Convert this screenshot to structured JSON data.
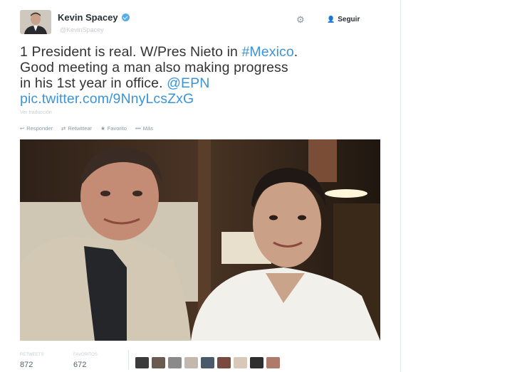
{
  "profile": {
    "name": "Kevin Spacey",
    "handle": "@KevinSpacey",
    "follow_label": "Seguir"
  },
  "tweet": {
    "line1_text": "1 President is real. W/Pres Nieto in ",
    "line1_hashtag": "#Mexico",
    "line1_end": ".",
    "line2": "Good meeting a man also making progress",
    "line3_text": "in his 1st year in office. ",
    "line3_mention": "@EPN",
    "line4_link": "pic.twitter.com/9NnyLcsZxG"
  },
  "location": "Ver traducción",
  "actions": {
    "reply": "Responder",
    "retweet": "Retwittear",
    "favorite": "Favorito",
    "more": "Más"
  },
  "stats": {
    "retweets_label": "RETWEETS",
    "retweets": "872",
    "favorites_label": "FAVORITOS",
    "favorites": "672"
  },
  "faces_colors": [
    "#3b3b3b",
    "#6a5a50",
    "#8a8a8a",
    "#c2b8ae",
    "#4a5a68",
    "#7a4a40",
    "#d8c8b8",
    "#2e2e2e",
    "#b07a6a"
  ],
  "icons": {
    "gear": "gear-icon",
    "follow": "add-user-icon",
    "verified": "verified-icon",
    "reply": "reply-icon",
    "retweet": "retweet-icon",
    "favorite": "star-icon",
    "more": "more-icon"
  }
}
